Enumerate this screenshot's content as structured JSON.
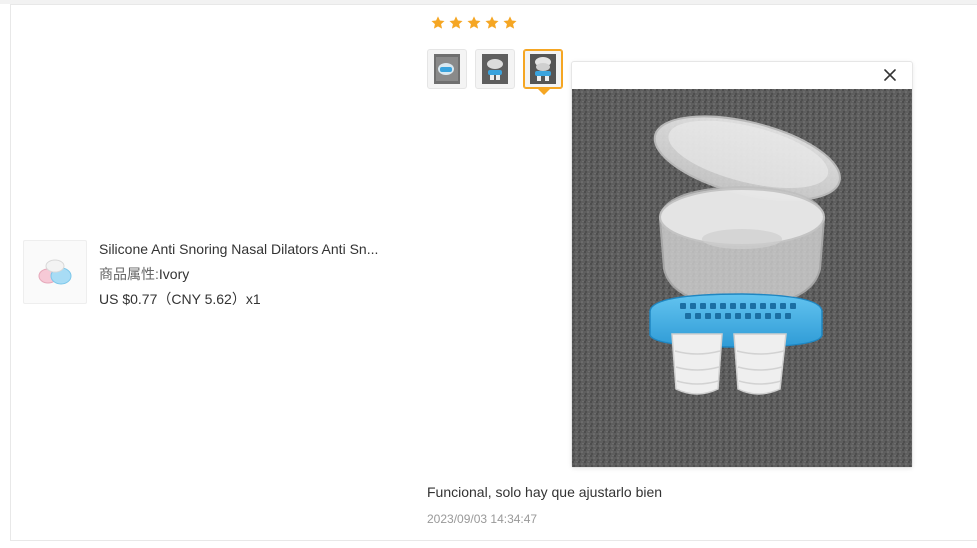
{
  "product": {
    "title": "Silicone Anti Snoring Nasal Dilators Anti Sn...",
    "attr_key": "商品属性:",
    "attr_value": "Ivory",
    "price": "US $0.77（CNY  5.62）x1"
  },
  "review": {
    "rating": 5,
    "star_color": "#f5a623",
    "photos": [
      {
        "name": "photo-thumb-1",
        "active": false
      },
      {
        "name": "photo-thumb-2",
        "active": false
      },
      {
        "name": "photo-thumb-3",
        "active": true
      }
    ],
    "comment": "Funcional, solo hay que ajustarlo bien",
    "date": "2023/09/03 14:34:47"
  },
  "icons": {
    "close": "close-icon",
    "star": "star-icon"
  }
}
